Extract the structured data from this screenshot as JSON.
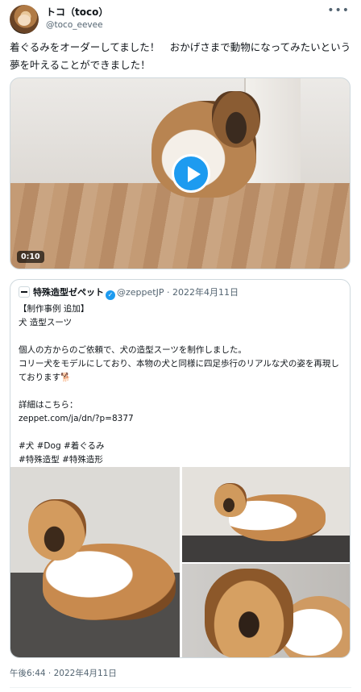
{
  "author": {
    "name": "トコ（toco）",
    "handle": "@toco_eevee"
  },
  "tweet": {
    "text": "着ぐるみをオーダーしてました！　おかげさまで動物になってみたいという夢を叶えることができました！",
    "video_duration": "0:10",
    "timestamp": "午後6:44 · 2022年4月11日"
  },
  "quoted": {
    "name": "特殊造型ゼペット",
    "handle": "@zeppetJP",
    "separator": "·",
    "date": "2022年4月11日",
    "text": "【制作事例 追加】\n犬 造型スーツ\n\n個人の方からのご依頼で、犬の造型スーツを制作しました。\nコリー犬をモデルにしており、本物の犬と同様に四足歩行のリアルな犬の姿を再現しております🐕\n\n詳細はこちら：\nzeppet.com/ja/dn/?p=8377\n\n#犬 #Dog #着ぐるみ\n#特殊造型 #特殊造形"
  },
  "icons": {
    "more": "more-icon",
    "play": "play-icon",
    "verified": "verified-badge-icon"
  },
  "colors": {
    "accent": "#1d9bf0",
    "text": "#0f1419",
    "secondary": "#536471",
    "border": "#cfd9de"
  }
}
